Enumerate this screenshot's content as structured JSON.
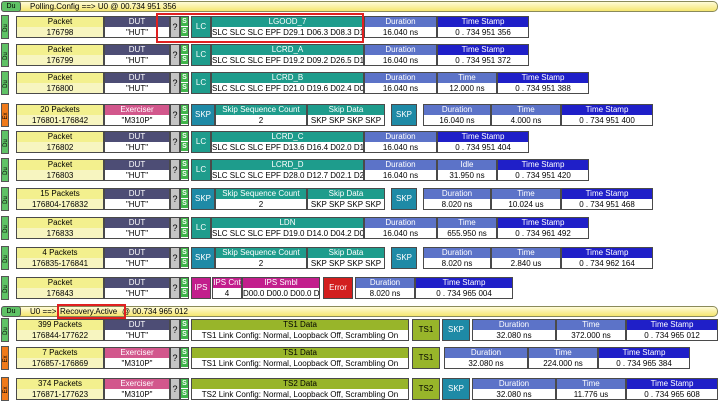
{
  "banners": [
    {
      "tag": "Du",
      "text": "Polling.Config ==> U0 @ 00.734 951 356"
    },
    {
      "tag": "Du",
      "text_prefix": "U0 ==> ",
      "text_state": "Recovery.Active",
      "text_suffix": " @ 00.734 965 012"
    }
  ],
  "packets": [
    {
      "strip": "Du",
      "pkt_label": "Packet",
      "pkt": "176798",
      "src_label": "DUT",
      "src": "\"HUT\"",
      "q": "?",
      "s": "S",
      "kind": "lc",
      "lc": "LC",
      "name": "LGOOD_7",
      "data": "SLC SLC SLC EPF D29.1 D06.3 D08.3 D15.0",
      "duration_label": "Duration",
      "duration": "16.040 ns",
      "ts_label": "Time Stamp",
      "ts": "0 . 734 951 356"
    },
    {
      "strip": "Du",
      "pkt_label": "Packet",
      "pkt": "176799",
      "src_label": "DUT",
      "src": "\"HUT\"",
      "q": "?",
      "s": "S",
      "kind": "lc",
      "lc": "LC",
      "name": "LCRD_A",
      "data": "SLC SLC SLC EPF D19.2 D09.2 D26.5 D13.3",
      "duration_label": "Duration",
      "duration": "16.040 ns",
      "ts_label": "Time Stamp",
      "ts": "0 . 734 951 372"
    },
    {
      "strip": "Du",
      "pkt_label": "Packet",
      "pkt": "176800",
      "src_label": "DUT",
      "src": "\"HUT\"",
      "q": "?",
      "s": "S",
      "kind": "lc",
      "lc": "LC",
      "name": "LCRD_B",
      "data": "SLC SLC SLC EPF D21.0 D19.6 D02.4 D06.4",
      "duration_label": "Duration",
      "duration": "16.040 ns",
      "time_label": "Time",
      "time": "12.000 ns",
      "ts_label": "Time Stamp",
      "ts": "0 . 734 951 388"
    },
    {
      "strip": "Ex",
      "pkt_label": "20 Packets",
      "pkt": "176801-176842",
      "src_label": "Exerciser",
      "src": "\"M310P\"",
      "q": "?",
      "s": "S",
      "kind": "skp",
      "skp": "SKP",
      "seq_label": "Skip Sequence Count",
      "seq": "2",
      "skd_label": "Skip Data",
      "skd": "SKP SKP SKP SKP",
      "skp2": "SKP",
      "duration_label": "Duration",
      "duration": "16.040 ns",
      "time_label": "Time",
      "time": "4.000 ns",
      "ts_label": "Time Stamp",
      "ts": "0 . 734 951 400"
    },
    {
      "strip": "Du",
      "pkt_label": "Packet",
      "pkt": "176802",
      "src_label": "DUT",
      "src": "\"HUT\"",
      "q": "?",
      "s": "S",
      "kind": "lc",
      "lc": "LC",
      "name": "LCRD_C",
      "data": "SLC SLC SLC EPF D13.6 D16.4 D02.0 D13.4",
      "duration_label": "Duration",
      "duration": "16.040 ns",
      "ts_label": "Time Stamp",
      "ts": "0 . 734 951 404"
    },
    {
      "strip": "Du",
      "pkt_label": "Packet",
      "pkt": "176803",
      "src_label": "DUT",
      "src": "\"HUT\"",
      "q": "?",
      "s": "S",
      "kind": "lc",
      "lc": "LC",
      "name": "LCRD_D",
      "data": "SLC SLC SLC EPF D28.0 D12.7 D02.1 D21.6",
      "duration_label": "Duration",
      "duration": "16.040 ns",
      "time_label": "Idle",
      "time": "31.950 ns",
      "ts_label": "Time Stamp",
      "ts": "0 . 734 951 420"
    },
    {
      "strip": "Du",
      "pkt_label": "15 Packets",
      "pkt": "176804-176832",
      "src_label": "DUT",
      "src": "\"HUT\"",
      "q": "?",
      "s": "S",
      "kind": "skp",
      "skp": "SKP",
      "seq_label": "Skip Sequence Count",
      "seq": "2",
      "skd_label": "Skip Data",
      "skd": "SKP SKP SKP SKP",
      "skp2": "SKP",
      "duration_label": "Duration",
      "duration": "8.020 ns",
      "time_label": "Time",
      "time": "10.024 us",
      "ts_label": "Time Stamp",
      "ts": "0 . 734 951 468"
    },
    {
      "strip": "Du",
      "pkt_label": "Packet",
      "pkt": "176833",
      "src_label": "DUT",
      "src": "\"HUT\"",
      "q": "?",
      "s": "S",
      "kind": "lc",
      "lc": "LC",
      "name": "LDN",
      "data": "SLC SLC SLC EPF D19.0 D14.0 D04.2 D09.7",
      "duration_label": "Duration",
      "duration": "16.040 ns",
      "time_label": "Time",
      "time": "655.950 ns",
      "ts_label": "Time Stamp",
      "ts": "0 . 734 961 492"
    },
    {
      "strip": "Du",
      "pkt_label": "4 Packets",
      "pkt": "176835-176841",
      "src_label": "DUT",
      "src": "\"HUT\"",
      "q": "?",
      "s": "S",
      "kind": "skp",
      "skp": "SKP",
      "seq_label": "Skip Sequence Count",
      "seq": "2",
      "skd_label": "Skip Data",
      "skd": "SKP SKP SKP SKP",
      "skp2": "SKP",
      "duration_label": "Duration",
      "duration": "8.020 ns",
      "time_label": "Time",
      "time": "2.840 us",
      "ts_label": "Time Stamp",
      "ts": "0 . 734 962 164"
    },
    {
      "strip": "Du",
      "pkt_label": "Packet",
      "pkt": "176843",
      "src_label": "DUT",
      "src": "\"HUT\"",
      "q": "?",
      "s": "S",
      "kind": "ips",
      "ips": "IPS",
      "cnt_label": "IPS Cnt",
      "cnt": "4",
      "smbl_label": "IPS Smbl",
      "smbl": "D00.0 D00.0 D00.0 D00.0",
      "err": "Error",
      "duration_label": "Duration",
      "duration": "8.020 ns",
      "ts_label": "Time Stamp",
      "ts": "0 . 734 965 004"
    },
    {
      "strip": "Du",
      "pkt_label": "399 Packets",
      "pkt": "176844-177622",
      "src_label": "DUT",
      "src": "\"HUT\"",
      "q": "?",
      "s": "S",
      "kind": "ts",
      "tsd_label": "TS1 Data",
      "tsd": "TS1 Link Config: Normal, Loopback Off, Scrambling On",
      "tsb": "TS1",
      "skp2": "SKP",
      "duration_label": "Duration",
      "duration": "32.080 ns",
      "time_label": "Time",
      "time": "372.000 ns",
      "ts_label": "Time Stamp",
      "ts": "0 . 734 965 012"
    },
    {
      "strip": "Ex",
      "pkt_label": "7 Packets",
      "pkt": "176857-176869",
      "src_label": "Exerciser",
      "src": "\"M310P\"",
      "q": "?",
      "s": "S",
      "kind": "ts",
      "tsd_label": "TS1 Data",
      "tsd": "TS1 Link Config: Normal, Loopback Off, Scrambling On",
      "tsb": "TS1",
      "duration_label": "Duration",
      "duration": "32.080 ns",
      "time_label": "Time",
      "time": "224.000 ns",
      "ts_label": "Time Stamp",
      "ts": "0 . 734 965 384"
    },
    {
      "strip": "Ex",
      "pkt_label": "374 Packets",
      "pkt": "176871-177623",
      "src_label": "Exerciser",
      "src": "\"M310P\"",
      "q": "?",
      "s": "S",
      "kind": "ts",
      "tsd_label": "TS2 Data",
      "tsd": "TS2 Link Config: Normal, Loopback Off, Scrambling On",
      "tsb": "TS2",
      "skp2": "SKP",
      "duration_label": "Duration",
      "duration": "32.080 ns",
      "time_label": "Time",
      "time": "11.776 us",
      "ts_label": "Time Stamp",
      "ts": "0 . 734 965 608"
    }
  ],
  "colors": {
    "highlight": "#e02020",
    "dut_header": "#4d4d75",
    "exerciser_header": "#d2578c",
    "lc": "#1e9c8c",
    "duration": "#5c73c8",
    "timestamp": "#1f1fc8",
    "ts1": "#98b52a",
    "ips": "#c21e8c",
    "error": "#d21e1e"
  }
}
